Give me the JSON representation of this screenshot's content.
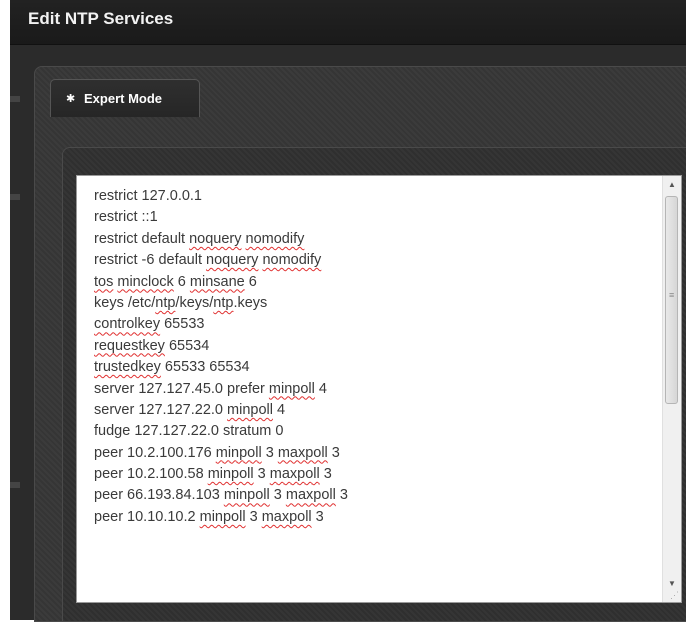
{
  "window": {
    "title": "Edit NTP Services"
  },
  "tabs": [
    {
      "label": "Expert Mode",
      "icon": "gear-icon",
      "active": true
    }
  ],
  "editor": {
    "lines": [
      [
        {
          "t": "restrict 127.0.0.1"
        }
      ],
      [
        {
          "t": "restrict ::1"
        }
      ],
      [
        {
          "t": "restrict default "
        },
        {
          "t": "noquery",
          "s": 1
        },
        {
          "t": " "
        },
        {
          "t": "nomodify",
          "s": 1
        }
      ],
      [
        {
          "t": "restrict -6 default "
        },
        {
          "t": "noquery",
          "s": 1
        },
        {
          "t": " "
        },
        {
          "t": "nomodify",
          "s": 1
        }
      ],
      [
        {
          "t": "tos",
          "s": 1
        },
        {
          "t": " "
        },
        {
          "t": "minclock",
          "s": 1
        },
        {
          "t": " 6 "
        },
        {
          "t": "minsane",
          "s": 1
        },
        {
          "t": " 6"
        }
      ],
      [
        {
          "t": "keys /etc/"
        },
        {
          "t": "ntp",
          "s": 1
        },
        {
          "t": "/keys/"
        },
        {
          "t": "ntp",
          "s": 1
        },
        {
          "t": ".keys"
        }
      ],
      [
        {
          "t": "controlkey",
          "s": 1
        },
        {
          "t": " 65533"
        }
      ],
      [
        {
          "t": "requestkey",
          "s": 1
        },
        {
          "t": " 65534"
        }
      ],
      [
        {
          "t": "trustedkey",
          "s": 1
        },
        {
          "t": " 65533 65534"
        }
      ],
      [
        {
          "t": "server 127.127.45.0 prefer "
        },
        {
          "t": "minpoll",
          "s": 1
        },
        {
          "t": " 4"
        }
      ],
      [
        {
          "t": "server 127.127.22.0 "
        },
        {
          "t": "minpoll",
          "s": 1
        },
        {
          "t": " 4"
        }
      ],
      [
        {
          "t": "fudge 127.127.22.0 stratum 0"
        }
      ],
      [
        {
          "t": "peer 10.2.100.176 "
        },
        {
          "t": "minpoll",
          "s": 1
        },
        {
          "t": " 3 "
        },
        {
          "t": "maxpoll",
          "s": 1
        },
        {
          "t": " 3"
        }
      ],
      [
        {
          "t": "peer 10.2.100.58 "
        },
        {
          "t": "minpoll",
          "s": 1
        },
        {
          "t": " 3 "
        },
        {
          "t": "maxpoll",
          "s": 1
        },
        {
          "t": " 3"
        }
      ],
      [
        {
          "t": "peer 66.193.84.103 "
        },
        {
          "t": "minpoll",
          "s": 1
        },
        {
          "t": " 3 "
        },
        {
          "t": "maxpoll",
          "s": 1
        },
        {
          "t": " 3"
        }
      ],
      [
        {
          "t": "peer 10.10.10.2 "
        },
        {
          "t": "minpoll",
          "s": 1
        },
        {
          "t": " 3 "
        },
        {
          "t": "maxpoll",
          "s": 1
        },
        {
          "t": " 3"
        }
      ]
    ],
    "scroll_fraction": 0.0
  },
  "colors": {
    "title_bar": "#1a1a1a",
    "panel": "#3b3b3b",
    "text": "#3a3a3a",
    "spellcheck": "#e03030"
  }
}
